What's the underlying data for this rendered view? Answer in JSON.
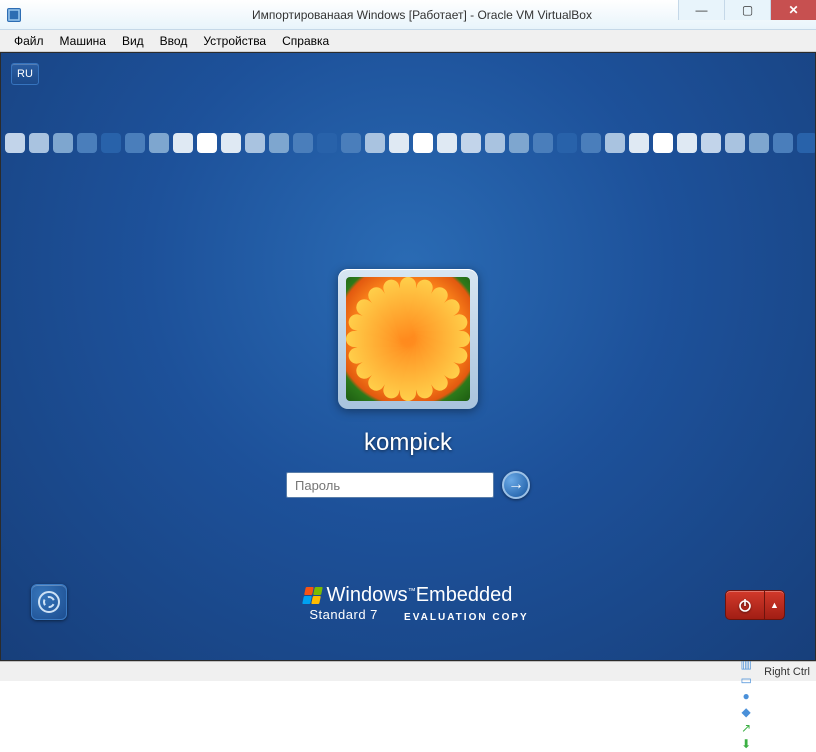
{
  "host_window": {
    "title": "Импортированаая Windows [Работает] - Oracle VM VirtualBox",
    "controls": {
      "minimize": "—",
      "maximize": "▢",
      "close": "✕"
    }
  },
  "menubar": {
    "items": [
      "Файл",
      "Машина",
      "Вид",
      "Ввод",
      "Устройства",
      "Справка"
    ]
  },
  "guest": {
    "language_indicator": "RU",
    "login": {
      "username": "kompick",
      "password_placeholder": "Пароль",
      "password_value": "",
      "submit_arrow": "→"
    },
    "branding": {
      "vendor": "Windows",
      "product": "Embedded",
      "tm": "™",
      "subtitle_left": "Standard 7",
      "subtitle_right": "EVALUATION COPY"
    },
    "ease_of_access_label": "ease-of-access",
    "power": {
      "main": "power",
      "options_caret": "▲"
    }
  },
  "statusbar": {
    "icons": [
      {
        "name": "hard-disk-icon",
        "glyph": "◎",
        "color": "#4a90d9"
      },
      {
        "name": "optical-icon",
        "glyph": "⊙",
        "color": "#4a90d9"
      },
      {
        "name": "network-icon",
        "glyph": "⇄",
        "color": "#4a90d9"
      },
      {
        "name": "usb-icon",
        "glyph": "⑂",
        "color": "#888"
      },
      {
        "name": "shared-folders-icon",
        "glyph": "▥",
        "color": "#4a90d9"
      },
      {
        "name": "display-icon",
        "glyph": "▭",
        "color": "#4a90d9"
      },
      {
        "name": "recording-icon",
        "glyph": "●",
        "color": "#4a90d9"
      },
      {
        "name": "guest-additions-icon",
        "glyph": "◆",
        "color": "#4a90d9"
      },
      {
        "name": "mouse-integration-icon",
        "glyph": "↗",
        "color": "#3cb043"
      },
      {
        "name": "keyboard-capture-icon",
        "glyph": "⬇",
        "color": "#3cb043"
      }
    ],
    "hostkey": "Right Ctrl"
  },
  "decorative_band_colors": [
    "#c2d4ea",
    "#a9c3e0",
    "#7ea6cf",
    "#4a7ebb",
    "#2862aa",
    "#4a7ebb",
    "#7ea6cf",
    "#dfe9f3",
    "#ffffff",
    "#dfe9f3",
    "#a9c3e0",
    "#7ea6cf",
    "#4a7ebb",
    "#2862aa",
    "#4a7ebb",
    "#a9c3e0",
    "#dfe9f3",
    "#ffffff",
    "#dfe9f3",
    "#c2d4ea",
    "#a9c3e0",
    "#7ea6cf",
    "#4a7ebb",
    "#2862aa",
    "#4a7ebb",
    "#a9c3e0",
    "#dfe9f3",
    "#ffffff",
    "#dfe9f3",
    "#c2d4ea",
    "#a9c3e0",
    "#7ea6cf",
    "#4a7ebb",
    "#2862aa",
    "#4a7ebb",
    "#a9c3e0",
    "#dfe9f3"
  ]
}
